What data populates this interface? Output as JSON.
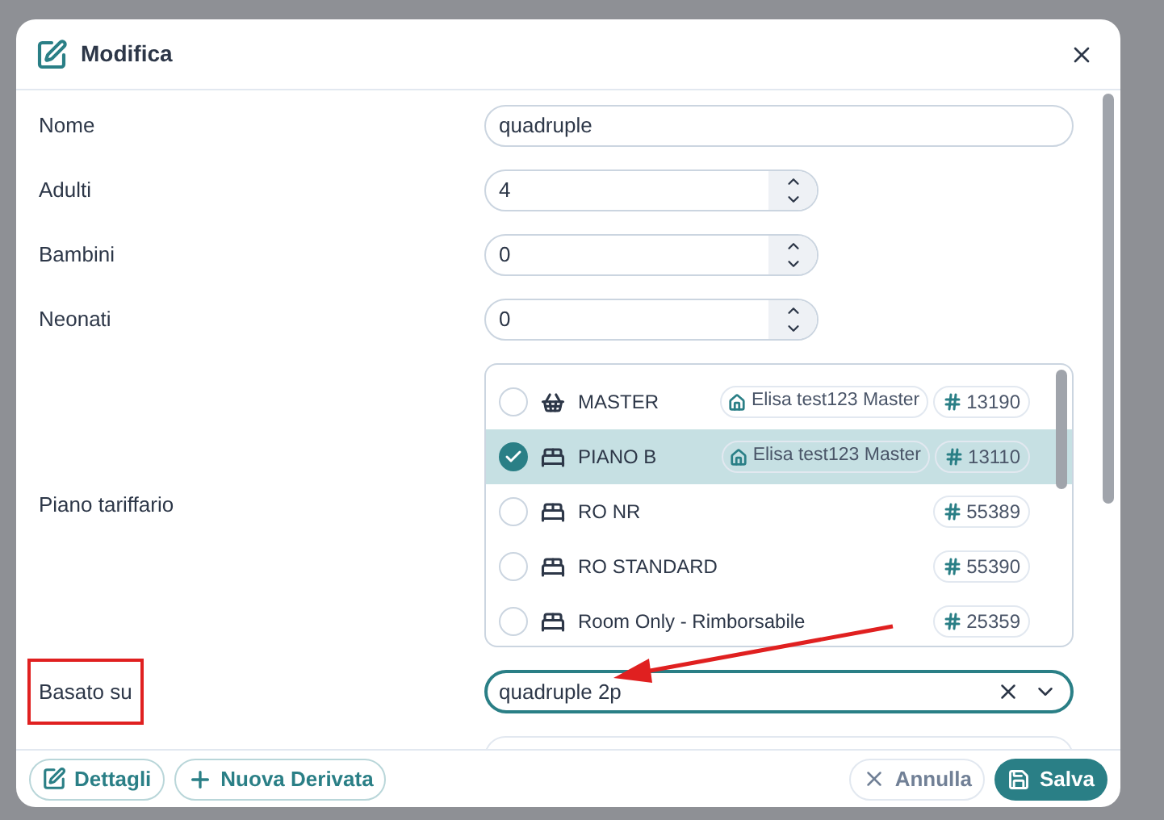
{
  "dialog": {
    "title": "Modifica"
  },
  "fields": [
    {
      "label": "Nome",
      "kind": "text",
      "value": "quadruple"
    },
    {
      "label": "Adulti",
      "kind": "number",
      "value": "4"
    },
    {
      "label": "Bambini",
      "kind": "number",
      "value": "0"
    },
    {
      "label": "Neonati",
      "kind": "number",
      "value": "0"
    }
  ],
  "rate_plan": {
    "label": "Piano tariffario",
    "items": [
      {
        "name": "MASTER",
        "kind": "master",
        "property": "Elisa test123 Master",
        "id": "13190",
        "selected": false
      },
      {
        "name": "PIANO B",
        "kind": "room",
        "property": "Elisa test123 Master",
        "id": "13110",
        "selected": true
      },
      {
        "name": "RO NR",
        "kind": "room",
        "id": "55389",
        "selected": false
      },
      {
        "name": "RO STANDARD",
        "kind": "room",
        "id": "55390",
        "selected": false
      },
      {
        "name": "Room Only - Rimborsabile",
        "kind": "room",
        "id": "25359",
        "selected": false
      }
    ]
  },
  "based_on": {
    "label": "Basato su",
    "value": "quadruple 2p",
    "highlighted": true
  },
  "footer": {
    "left": [
      {
        "label": "Dettagli",
        "kind": "details"
      },
      {
        "label": "Nuova Derivata",
        "kind": "new"
      }
    ],
    "cancel": "Annulla",
    "save": "Salva"
  }
}
